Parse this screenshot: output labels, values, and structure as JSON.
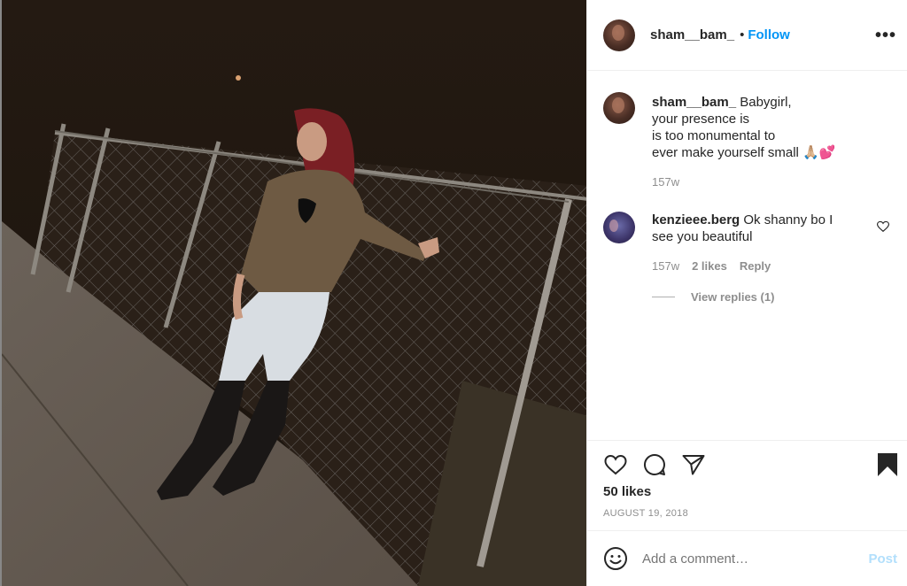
{
  "post": {
    "image_alt": "Night photo of a woman in a brown jacket, light jeans and black boots leaning on a chain-link fence",
    "author": "sham__bam_",
    "follow_label": "Follow",
    "dot": "•",
    "more_label": "•••"
  },
  "comments": [
    {
      "user": "sham__bam_",
      "lines": [
        "Babygirl,",
        "your presence is",
        "is too monumental to",
        "ever make yourself small 🙏🏼💕"
      ],
      "time": "157w"
    },
    {
      "user": "kenzieee.berg",
      "text": "Ok shanny bo I see you beautiful",
      "time": "157w",
      "likes": "2 likes",
      "reply_label": "Reply",
      "view_replies": "View replies (1)"
    }
  ],
  "actions": {
    "icons": [
      "heart-icon",
      "comment-icon",
      "share-icon",
      "bookmark-icon"
    ],
    "likes": "50 likes",
    "date": "AUGUST 19, 2018"
  },
  "add_comment": {
    "placeholder": "Add a comment…",
    "post_label": "Post"
  },
  "colors": {
    "link": "#0095f6",
    "muted": "#8e8e8e",
    "post_disabled": "#b2dffc"
  }
}
